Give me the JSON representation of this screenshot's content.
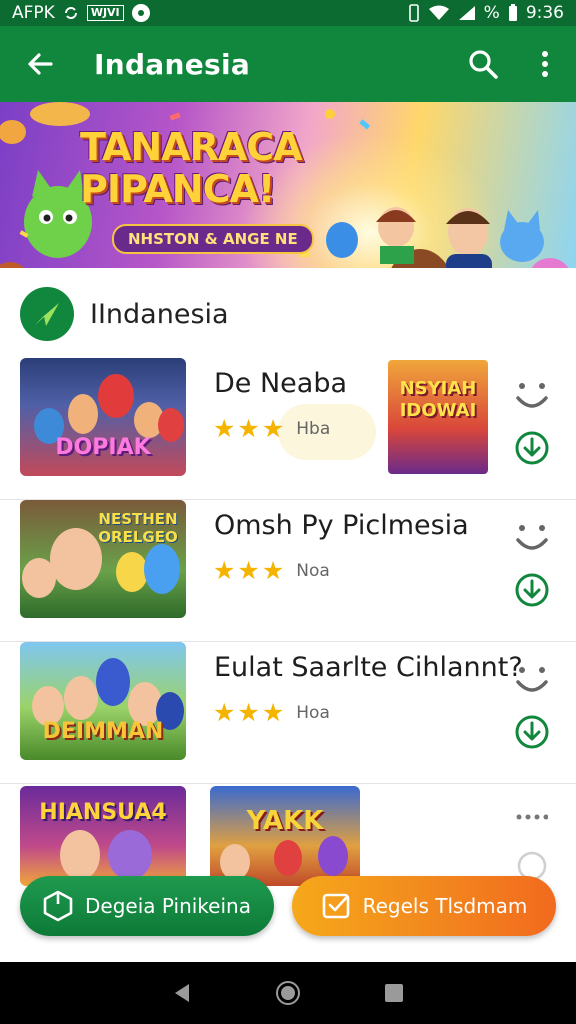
{
  "status_bar": {
    "left_text": "AFPK",
    "box_text": "WJVI",
    "time": "9:36"
  },
  "app_bar": {
    "title": "Indanesia",
    "back_icon": "arrow-back-icon",
    "search_icon": "search-icon",
    "more_icon": "more-vert-icon"
  },
  "banner": {
    "title_line1": "TANARACA",
    "title_line2": "PIPANCA!",
    "subtitle": "NHSTON & ANGE NE"
  },
  "section": {
    "title": "IIndanesia",
    "logo_icon": "paper-plane-icon"
  },
  "rows": [
    {
      "title": "De Neaba",
      "rating_label": "Hba",
      "thumb_title": "DOPIAK",
      "thumb2_title": "NSYIAH IDOWAI"
    },
    {
      "title": "Omsh Py Piclmesia",
      "rating_label": "Noa",
      "thumb_title": "NESTHEN ORELGEO"
    },
    {
      "title": "Eulat Saarlte Cihlannt?",
      "rating_label": "Hoa",
      "thumb_title": "DEIMMAN"
    }
  ],
  "partial_row": {
    "thumb_title": "HIANSUA4",
    "thumb2_title": "YAKK"
  },
  "buttons": {
    "left_label": "Degeia Pinikeina",
    "right_label": "Regels Tlsdmam"
  },
  "colors": {
    "primary": "#11873d",
    "status": "#0b6b30",
    "star": "#f5b400",
    "accent_orange": "#f28a1e"
  }
}
